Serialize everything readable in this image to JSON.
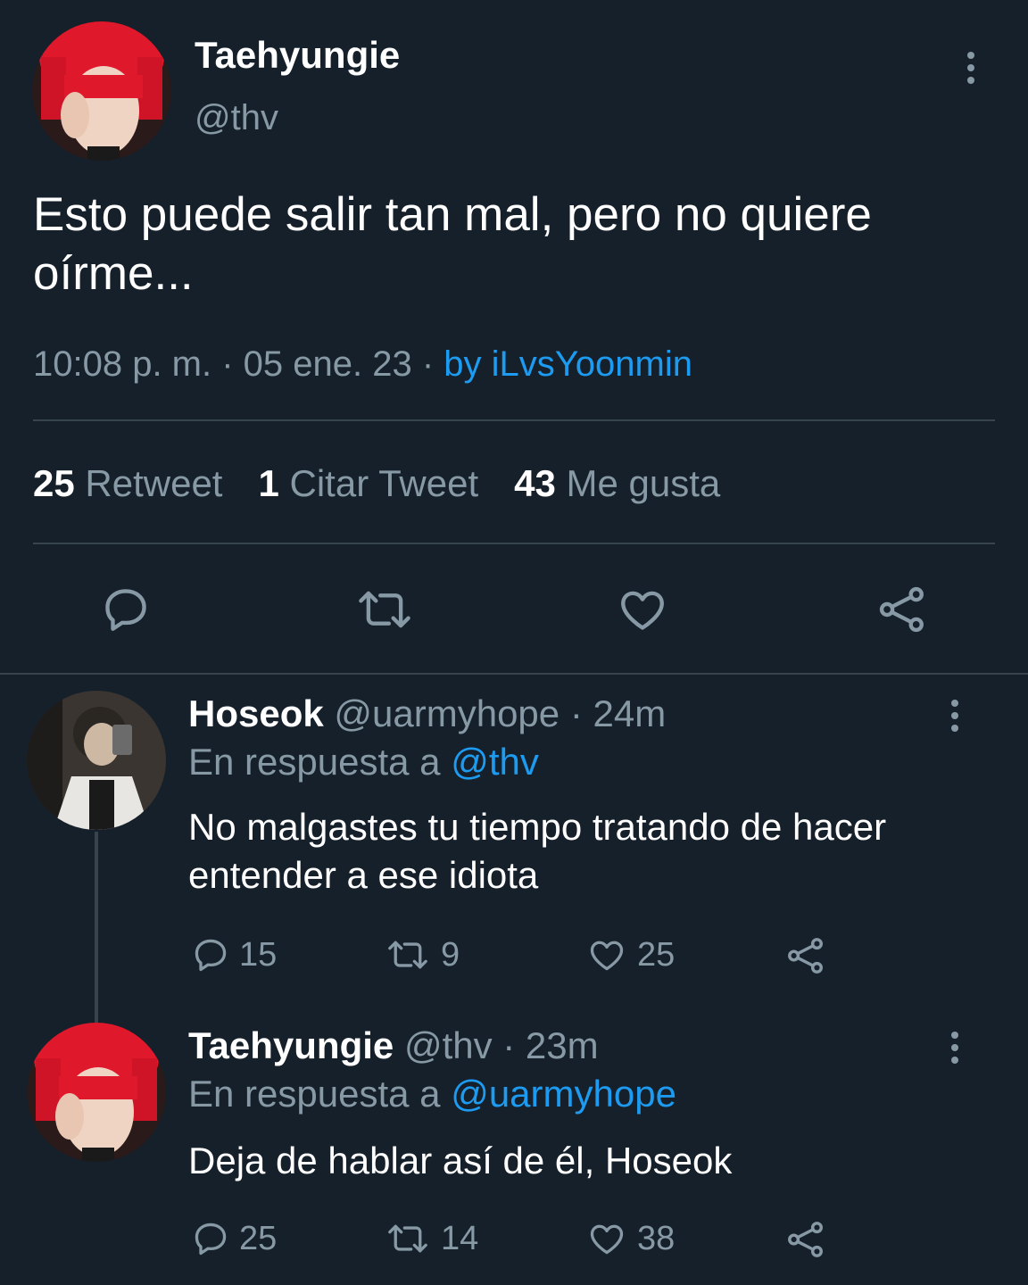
{
  "main_tweet": {
    "display_name": "Taehyungie",
    "handle": "@thv",
    "text": "Esto puede salir tan mal, pero no quiere oírme...",
    "time": "10:08 p. m. · 05 ene. 23 · ",
    "source": "by iLvsYoonmin",
    "stats": {
      "retweets_count": "25",
      "retweets_label": "Retweet",
      "quotes_count": "1",
      "quotes_label": "Citar Tweet",
      "likes_count": "43",
      "likes_label": "Me gusta"
    },
    "icons": [
      "reply-icon",
      "retweet-icon",
      "like-icon",
      "share-icon"
    ]
  },
  "replies": [
    {
      "display_name": "Hoseok",
      "handle": "@uarmyhope",
      "time": " · 24m",
      "reply_prefix": "En respuesta a ",
      "reply_to": "@thv",
      "text": "No malgastes tu tiempo tratando de hacer entender a ese idiota",
      "replies": "15",
      "retweets": "9",
      "likes": "25"
    },
    {
      "display_name": "Taehyungie",
      "handle": "@thv",
      "time": " · 23m",
      "reply_prefix": "En respuesta a ",
      "reply_to": "@uarmyhope",
      "text": "Deja de hablar así de él, Hoseok",
      "replies": "25",
      "retweets": "14",
      "likes": "38"
    }
  ],
  "colors": {
    "background": "#15202b",
    "muted": "#8899a6",
    "accent": "#1d9bf0",
    "divider": "#38444d"
  }
}
